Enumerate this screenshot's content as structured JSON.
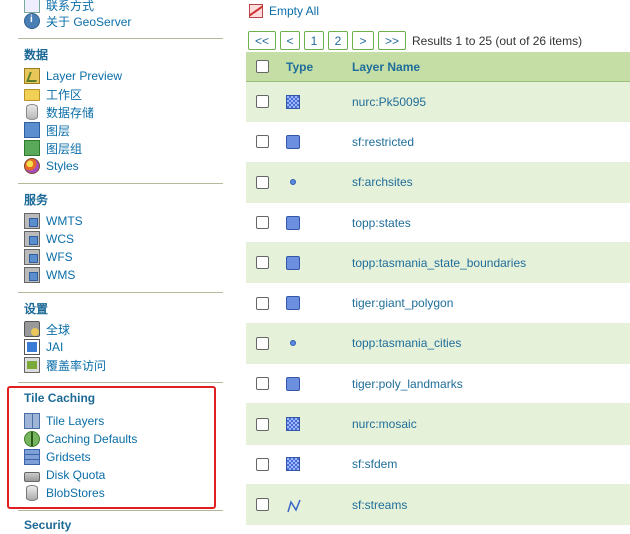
{
  "sidebar": {
    "top_links": [
      {
        "label": "联系方式",
        "icon": "contact-icon"
      },
      {
        "label": "关于 GeoServer",
        "icon": "info-icon"
      }
    ],
    "sections": [
      {
        "title": "数据",
        "items": [
          {
            "label": "Layer Preview",
            "icon": "layer-preview-icon"
          },
          {
            "label": "工作区",
            "icon": "folder-icon"
          },
          {
            "label": "数据存储",
            "icon": "database-icon"
          },
          {
            "label": "图层",
            "icon": "layer-icon"
          },
          {
            "label": "图层组",
            "icon": "layer-group-icon"
          },
          {
            "label": "Styles",
            "icon": "styles-icon"
          }
        ]
      },
      {
        "title": "服务",
        "items": [
          {
            "label": "WMTS",
            "icon": "service-icon"
          },
          {
            "label": "WCS",
            "icon": "service-icon"
          },
          {
            "label": "WFS",
            "icon": "service-icon"
          },
          {
            "label": "WMS",
            "icon": "service-icon"
          }
        ]
      },
      {
        "title": "设置",
        "items": [
          {
            "label": "全球",
            "icon": "global-settings-icon"
          },
          {
            "label": "JAI",
            "icon": "jai-icon"
          },
          {
            "label": "覆盖率访问",
            "icon": "coverage-access-icon"
          }
        ]
      },
      {
        "title": "Tile Caching",
        "items": [
          {
            "label": "Tile Layers",
            "icon": "tile-layers-icon"
          },
          {
            "label": "Caching Defaults",
            "icon": "caching-defaults-icon"
          },
          {
            "label": "Gridsets",
            "icon": "gridsets-icon"
          },
          {
            "label": "Disk Quota",
            "icon": "disk-quota-icon"
          },
          {
            "label": "BlobStores",
            "icon": "blobstores-icon"
          }
        ]
      },
      {
        "title": "Security",
        "items": []
      }
    ]
  },
  "main": {
    "empty_all_label": "Empty All",
    "pager": {
      "buttons": [
        "<<",
        "<",
        "1",
        "2",
        ">",
        ">>"
      ],
      "results_text": "Results 1 to 25 (out of 26 items)"
    },
    "table": {
      "headers": {
        "type": "Type",
        "name": "Layer Name"
      },
      "rows": [
        {
          "type": "raster",
          "name": "nurc:Pk50095"
        },
        {
          "type": "polygon",
          "name": "sf:restricted"
        },
        {
          "type": "point",
          "name": "sf:archsites"
        },
        {
          "type": "polygon",
          "name": "topp:states"
        },
        {
          "type": "polygon",
          "name": "topp:tasmania_state_boundaries"
        },
        {
          "type": "polygon",
          "name": "tiger:giant_polygon"
        },
        {
          "type": "point",
          "name": "topp:tasmania_cities"
        },
        {
          "type": "polygon",
          "name": "tiger:poly_landmarks"
        },
        {
          "type": "raster",
          "name": "nurc:mosaic"
        },
        {
          "type": "raster",
          "name": "sf:sfdem"
        },
        {
          "type": "line",
          "name": "sf:streams"
        }
      ]
    }
  }
}
